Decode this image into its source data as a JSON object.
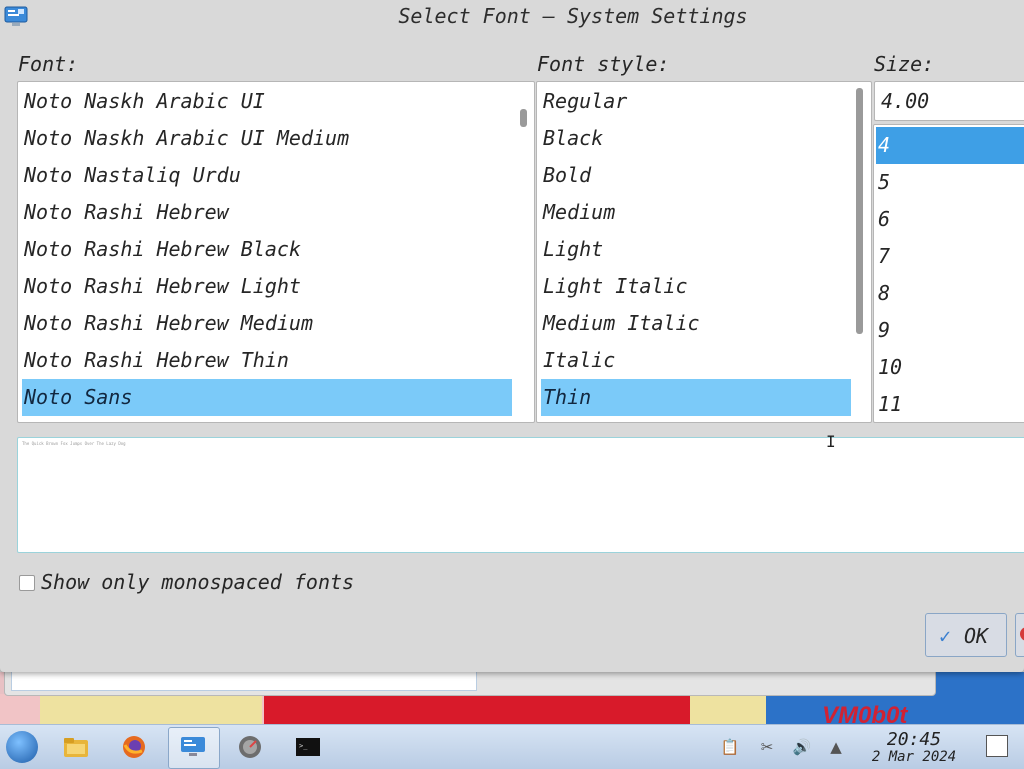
{
  "window": {
    "title": "Select Font — System Settings"
  },
  "font_panel": {
    "label": "Font:",
    "items": [
      "Noto Naskh Arabic UI",
      "Noto Naskh Arabic UI Medium",
      "Noto Nastaliq Urdu",
      "Noto Rashi Hebrew",
      "Noto Rashi Hebrew Black",
      "Noto Rashi Hebrew Light",
      "Noto Rashi Hebrew Medium",
      "Noto Rashi Hebrew Thin",
      "Noto Sans"
    ],
    "selected": "Noto Sans"
  },
  "style_panel": {
    "label": "Font style:",
    "items": [
      "Regular",
      "Black",
      "Bold",
      "Medium",
      "Light",
      "Light Italic",
      "Medium Italic",
      "Italic",
      "Thin"
    ],
    "selected": "Thin"
  },
  "size_panel": {
    "label": "Size:",
    "value": "4.00",
    "items": [
      "4",
      "5",
      "6",
      "7",
      "8",
      "9",
      "10",
      "11"
    ],
    "selected": "4"
  },
  "preview": {
    "text": "The Quick Brown Fox Jumps Over The Lazy Dog"
  },
  "monospace_option": {
    "label": "Show only monospaced fonts",
    "checked": false
  },
  "buttons": {
    "ok": "OK"
  },
  "wallpaper": {
    "logo": "VM0b0t"
  },
  "taskbar": {
    "clock_time": "20:45",
    "clock_date": "2 Mar 2024",
    "icons": [
      "start-orb-icon",
      "file-manager-icon",
      "firefox-icon",
      "system-settings-icon",
      "disk-utility-icon",
      "terminal-icon"
    ],
    "tray_icons": [
      "clipboard-icon",
      "scissors-icon",
      "volume-icon",
      "expand-tray-icon"
    ]
  },
  "colors": {
    "selection": "#7bcaf9",
    "size_selection": "#3e9fe6"
  }
}
